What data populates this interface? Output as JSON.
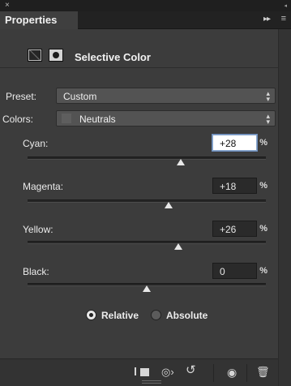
{
  "window": {
    "close_glyph": "×",
    "grip_glyph": "◂"
  },
  "tab": {
    "label": "Properties",
    "collapse_glyph": "▸▸",
    "menu_glyph": "≡"
  },
  "panel": {
    "title": "Selective Color",
    "icons": [
      "adjustment-icon",
      "mask-icon"
    ]
  },
  "preset": {
    "label": "Preset:",
    "value": "Custom"
  },
  "colors": {
    "label": "Colors:",
    "value": "Neutrals"
  },
  "dropdown_arrow": "⌃⌄",
  "sliders": [
    {
      "name": "cyan",
      "label": "Cyan:",
      "value": "+28",
      "position": 0.64,
      "active": true
    },
    {
      "name": "magenta",
      "label": "Magenta:",
      "value": "+18",
      "position": 0.59,
      "active": false
    },
    {
      "name": "yellow",
      "label": "Yellow:",
      "value": "+26",
      "position": 0.63,
      "active": false
    },
    {
      "name": "black",
      "label": "Black:",
      "value": "0",
      "position": 0.5,
      "active": false
    }
  ],
  "percent_symbol": "%",
  "method": {
    "relative_label": "Relative",
    "absolute_label": "Absolute",
    "selected": "Relative"
  },
  "bottom_bar": {
    "icons": [
      "clip-to-layer-icon",
      "view-previous-icon",
      "reset-icon",
      "visibility-icon",
      "trash-icon"
    ],
    "glyphs": {
      "view_previous": "◎›",
      "reset": "↺",
      "visibility": "◉",
      "trash": "🗑"
    }
  },
  "colors_ui": {
    "panel_bg": "#3c3c3c",
    "accent_focus": "#6d8dbb"
  }
}
